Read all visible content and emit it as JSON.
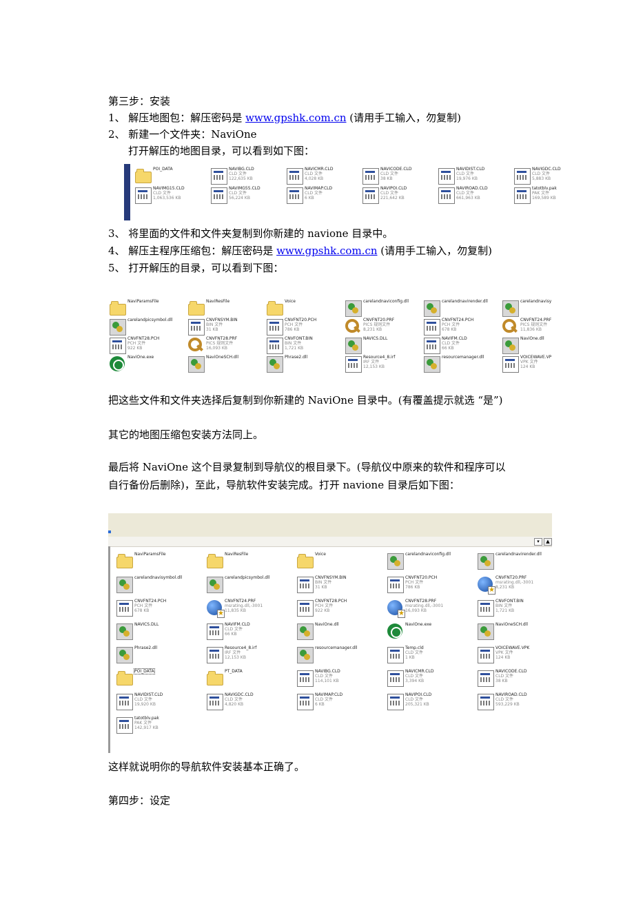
{
  "doc": {
    "step3_heading": "第三步：安装",
    "item1_prefix": "1、 解压地图包：解压密码是 ",
    "item1_link": "www.gpshk.com.cn",
    "item1_suffix": " (请用手工输入，勿复制)",
    "item2": "2、 新建一个文件夹：NaviOne",
    "item2_sub": "打开解压的地图目录，可以看到如下图：",
    "item3": "3、 将里面的文件和文件夹复制到你新建的 navione 目录中。",
    "item4_prefix": "4、 解压主程序压缩包：解压密码是 ",
    "item4_link": "www.gpshk.com.cn",
    "item4_suffix": " (请用手工输入，勿复制)",
    "item5": "5、 打开解压的目录，可以看到下图：",
    "para1": "把这些文件和文件夹选择后复制到你新建的 NaviOne 目录中。(有覆盖提示就选 “是”)",
    "para2": "其它的地图压缩包安装方法同上。",
    "para3_line1": "最后将 NaviOne 这个目录复制到导航仪的根目录下。(导航仪中原来的软件和程序可以",
    "para3_line2": "自行备份后删除)，至此，导航软件安装完成。打开 navione 目录后如下图：",
    "para4": "这样就说明你的导航软件安装基本正确了。",
    "step4_heading": "第四步：设定"
  },
  "shots": [
    {
      "name": "map-folder-screenshot",
      "items": [
        {
          "n": "POI_DATA",
          "t": "",
          "s": "",
          "i": "folder"
        },
        {
          "n": "NAVIBG.CLD",
          "t": "CLD 文件",
          "s": "122,635 KB",
          "i": "cld"
        },
        {
          "n": "NAVICMR.CLD",
          "t": "CLD 文件",
          "s": "4,028 KB",
          "i": "cld"
        },
        {
          "n": "NAVICODE.CLD",
          "t": "CLD 文件",
          "s": "38 KB",
          "i": "cld"
        },
        {
          "n": "NAVIDIST.CLD",
          "t": "CLD 文件",
          "s": "19,976 KB",
          "i": "cld"
        },
        {
          "n": "NAVIGDC.CLD",
          "t": "CLD 文件",
          "s": "5,883 KB",
          "i": "cld"
        },
        {
          "n": "NAVIMG15.CLD",
          "t": "CLD 文件",
          "s": "1,063,536 KB",
          "i": "cld"
        },
        {
          "n": "NAVIMG55.CLD",
          "t": "CLD 文件",
          "s": "56,224 KB",
          "i": "cld"
        },
        {
          "n": "NAVIMAP.CLD",
          "t": "CLD 文件",
          "s": "6 KB",
          "i": "cld"
        },
        {
          "n": "NAVIPOI.CLD",
          "t": "CLD 文件",
          "s": "221,642 KB",
          "i": "cld"
        },
        {
          "n": "NAVIROAD.CLD",
          "t": "CLD 文件",
          "s": "661,963 KB",
          "i": "cld"
        },
        {
          "n": "tatotblv.pak",
          "t": "PAK 文件",
          "s": "169,589 KB",
          "i": "cld"
        }
      ]
    },
    {
      "name": "program-folder-screenshot",
      "items": [
        {
          "n": "NaviParamsFile",
          "t": "",
          "s": "",
          "i": "folder"
        },
        {
          "n": "NaviResFile",
          "t": "",
          "s": "",
          "i": "folder"
        },
        {
          "n": "Voice",
          "t": "",
          "s": "",
          "i": "folder"
        },
        {
          "n": "carelandnaviconfig.dll",
          "t": "",
          "s": "",
          "i": "dll"
        },
        {
          "n": "carelandnavirender.dll",
          "t": "",
          "s": "",
          "i": "dll"
        },
        {
          "n": "carelandnavisymb",
          "t": "",
          "s": "",
          "i": "dll"
        },
        {
          "n": "carelandpicsymbol.dll",
          "t": "",
          "s": "",
          "i": "dll"
        },
        {
          "n": "CNVFNSYM.BIN",
          "t": "BIN 文件",
          "s": "31 KB",
          "i": "cld"
        },
        {
          "n": "CNVFNT20.PCH",
          "t": "PCH 文件",
          "s": "786 KB",
          "i": "cld"
        },
        {
          "n": "CNVFNT20.PRF",
          "t": "PICS 规则文件",
          "s": "8,231 KB",
          "i": "key"
        },
        {
          "n": "CNVFNT24.PCH",
          "t": "PCH 文件",
          "s": "678 KB",
          "i": "cld"
        },
        {
          "n": "CNVFNT24.PRF",
          "t": "PICS 规则文件",
          "s": "11,836 KB",
          "i": "key"
        },
        {
          "n": "CNVFNT28.PCH",
          "t": "PCH 文件",
          "s": "922 KB",
          "i": "cld"
        },
        {
          "n": "CNVFNT28.PRF",
          "t": "PICS 规则文件",
          "s": "16,093 KB",
          "i": "key"
        },
        {
          "n": "CNVFONT.BIN",
          "t": "BIN 文件",
          "s": "1,721 KB",
          "i": "cld"
        },
        {
          "n": "NAVICS.DLL",
          "t": "",
          "s": "",
          "i": "dll"
        },
        {
          "n": "NAVIFM.CLD",
          "t": "CLD 文件",
          "s": "66 KB",
          "i": "cld"
        },
        {
          "n": "NaviOne.dll",
          "t": "",
          "s": "",
          "i": "dll"
        },
        {
          "n": "NaviOne.exe",
          "t": "",
          "s": "",
          "i": "exe"
        },
        {
          "n": "NaviOneSCH.dll",
          "t": "",
          "s": "",
          "i": "dll"
        },
        {
          "n": "Phrase2.dll",
          "t": "",
          "s": "",
          "i": "dll"
        },
        {
          "n": "Resource4_8.irf",
          "t": "IRF 文件",
          "s": "12,153 KB",
          "i": "cld"
        },
        {
          "n": "resourcemanager.dll",
          "t": "",
          "s": "",
          "i": "dll"
        },
        {
          "n": "VOICEWAVE.VPK",
          "t": "VPK 文件",
          "s": "124 KB",
          "i": "cld"
        }
      ]
    },
    {
      "name": "navione-folder-screenshot",
      "items": [
        {
          "n": "NaviParamsFile",
          "t": "",
          "s": "",
          "i": "folder"
        },
        {
          "n": "NaviResFile",
          "t": "",
          "s": "",
          "i": "folder"
        },
        {
          "n": "Voice",
          "t": "",
          "s": "",
          "i": "folder"
        },
        {
          "n": "carelandnaviconfig.dll",
          "t": "",
          "s": "",
          "i": "dll"
        },
        {
          "n": "carelandnavirender.dll",
          "t": "",
          "s": "",
          "i": "dll"
        },
        {
          "n": "carelandnavisymbol.dll",
          "t": "",
          "s": "",
          "i": "dll"
        },
        {
          "n": "carelandpicsymbol.dll",
          "t": "",
          "s": "",
          "i": "dll"
        },
        {
          "n": "CNVFNSYM.BIN",
          "t": "BIN 文件",
          "s": "31 KB",
          "i": "cld"
        },
        {
          "n": "CNVFNT20.PCH",
          "t": "PCH 文件",
          "s": "786 KB",
          "i": "cld"
        },
        {
          "n": "CNVFNT20.PRF",
          "t": "msrating.dll,-3001",
          "s": "8,231 KB",
          "i": "globe"
        },
        {
          "n": "CNVFNT24.PCH",
          "t": "PCH 文件",
          "s": "678 KB",
          "i": "cld"
        },
        {
          "n": "CNVFNT24.PRF",
          "t": "msrating.dll,-3001",
          "s": "11,835 KB",
          "i": "globe"
        },
        {
          "n": "CNVFNT28.PCH",
          "t": "PCH 文件",
          "s": "922 KB",
          "i": "cld"
        },
        {
          "n": "CNVFNT28.PRF",
          "t": "msrating.dll,-3001",
          "s": "16,093 KB",
          "i": "globe"
        },
        {
          "n": "CNVFONT.BIN",
          "t": "BIN 文件",
          "s": "1,721 KB",
          "i": "cld"
        },
        {
          "n": "NAVICS.DLL",
          "t": "",
          "s": "",
          "i": "dll"
        },
        {
          "n": "NAVIFM.CLD",
          "t": "CLD 文件",
          "s": "66 KB",
          "i": "cld"
        },
        {
          "n": "NaviOne.dll",
          "t": "",
          "s": "",
          "i": "dll"
        },
        {
          "n": "NaviOne.exe",
          "t": "",
          "s": "",
          "i": "exe"
        },
        {
          "n": "NaviOneSCH.dll",
          "t": "",
          "s": "",
          "i": "dll"
        },
        {
          "n": "Phrase2.dll",
          "t": "",
          "s": "",
          "i": "dll"
        },
        {
          "n": "Resource4_8.irf",
          "t": "IRF 文件",
          "s": "12,153 KB",
          "i": "cld"
        },
        {
          "n": "resourcemanager.dll",
          "t": "",
          "s": "",
          "i": "dll"
        },
        {
          "n": "Temp.cld",
          "t": "CLD 文件",
          "s": "1 KB",
          "i": "cld"
        },
        {
          "n": "VOICEWAVE.VPK",
          "t": "VPK 文件",
          "s": "124 KB",
          "i": "cld"
        },
        {
          "n": "POI_DATA",
          "t": "",
          "s": "",
          "i": "folder",
          "sel": true
        },
        {
          "n": "PT_DATA",
          "t": "",
          "s": "",
          "i": "folder"
        },
        {
          "n": "NAVIBG.CLD",
          "t": "CLD 文件",
          "s": "114,101 KB",
          "i": "cld"
        },
        {
          "n": "NAVICMR.CLD",
          "t": "CLD 文件",
          "s": "3,394 KB",
          "i": "cld"
        },
        {
          "n": "NAVICODE.CLD",
          "t": "CLD 文件",
          "s": "38 KB",
          "i": "cld"
        },
        {
          "n": "NAVIDIST.CLD",
          "t": "CLD 文件",
          "s": "19,920 KB",
          "i": "cld"
        },
        {
          "n": "NAVIGDC.CLD",
          "t": "CLD 文件",
          "s": "4,820 KB",
          "i": "cld"
        },
        {
          "n": "NAVIMAP.CLD",
          "t": "CLD 文件",
          "s": "6 KB",
          "i": "cld"
        },
        {
          "n": "NAVIPOI.CLD",
          "t": "CLD 文件",
          "s": "205,321 KB",
          "i": "cld"
        },
        {
          "n": "NAVIROAD.CLD",
          "t": "CLD 文件",
          "s": "593,229 KB",
          "i": "cld"
        },
        {
          "n": "tatotblv.pak",
          "t": "PAK 文件",
          "s": "142,917 KB",
          "i": "cld"
        }
      ]
    }
  ]
}
